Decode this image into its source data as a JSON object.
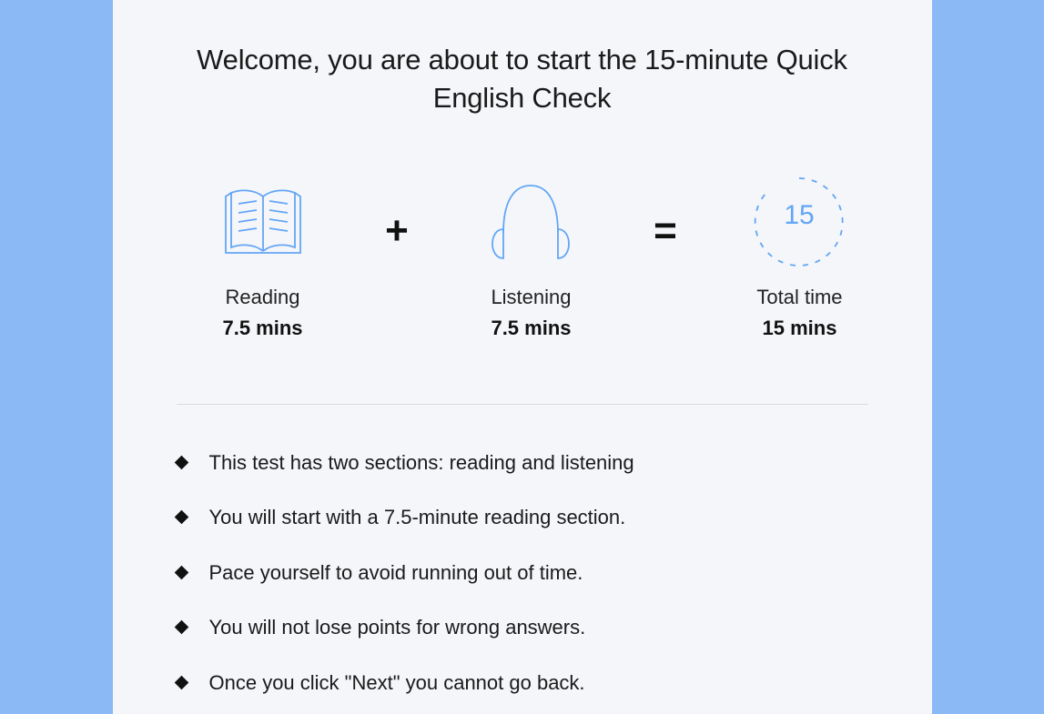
{
  "colors": {
    "accent": "#63a6f5",
    "page_bg": "#8ab9f5",
    "card_bg": "#f4f6fa",
    "text": "#1a1a1a"
  },
  "title": "Welcome, you are about to start the 15-minute Quick English Check",
  "sections": {
    "reading": {
      "label": "Reading",
      "duration": "7.5 mins"
    },
    "listening": {
      "label": "Listening",
      "duration": "7.5 mins"
    },
    "total": {
      "label": "Total time",
      "duration": "15 mins",
      "timer_value": "15"
    }
  },
  "operators": {
    "plus": "+",
    "equals": "="
  },
  "bullets": [
    "This test has two sections: reading and listening",
    "You will start with a 7.5-minute reading section.",
    "Pace yourself to avoid running out of time.",
    "You will not lose points for wrong answers.",
    "Once you click \"Next\" you cannot go back."
  ]
}
